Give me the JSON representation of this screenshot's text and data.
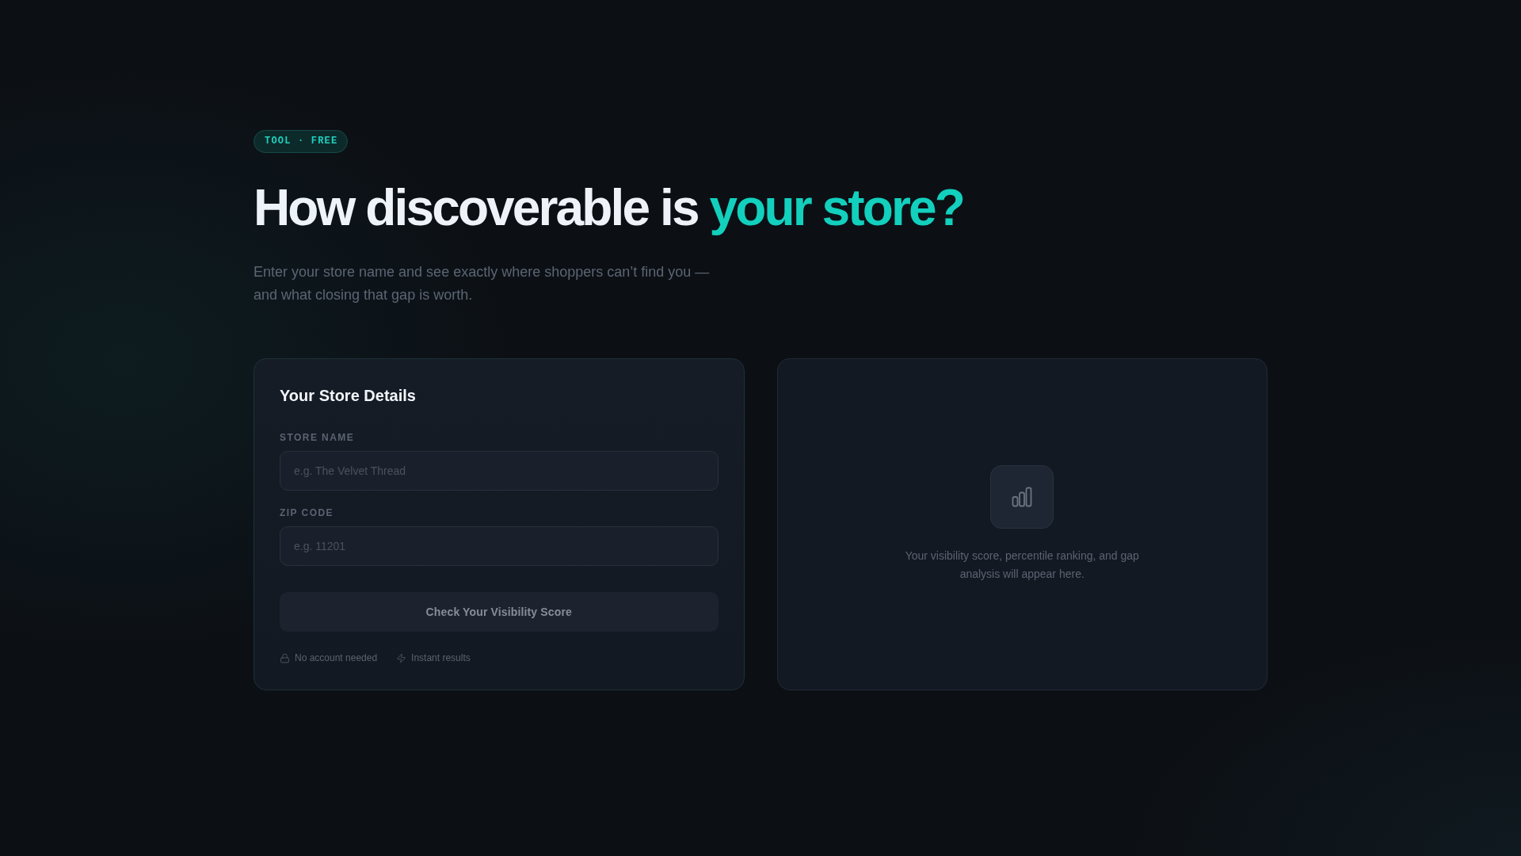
{
  "badge": {
    "text": "TOOL · FREE"
  },
  "heading": {
    "text": "How discoverable is",
    "highlight": "your store?"
  },
  "subtitle": "Enter your store name and see exactly where shoppers can’t find you — and what closing that gap is worth.",
  "form": {
    "title": "Your Store Details",
    "fields": [
      {
        "label": "STORE NAME",
        "placeholder": "e.g. The Velvet Thread"
      },
      {
        "label": "ZIP CODE",
        "placeholder": "e.g. 11201"
      }
    ],
    "button": {
      "label": "Check Your Visibility Score",
      "disabled": true
    },
    "notes": [
      {
        "kind": "lock",
        "text": "No account needed"
      },
      {
        "kind": "bolt",
        "text": "Instant results"
      }
    ]
  },
  "results": {
    "message": "Your visibility score, percentile ranking, and gap analysis will appear here."
  }
}
